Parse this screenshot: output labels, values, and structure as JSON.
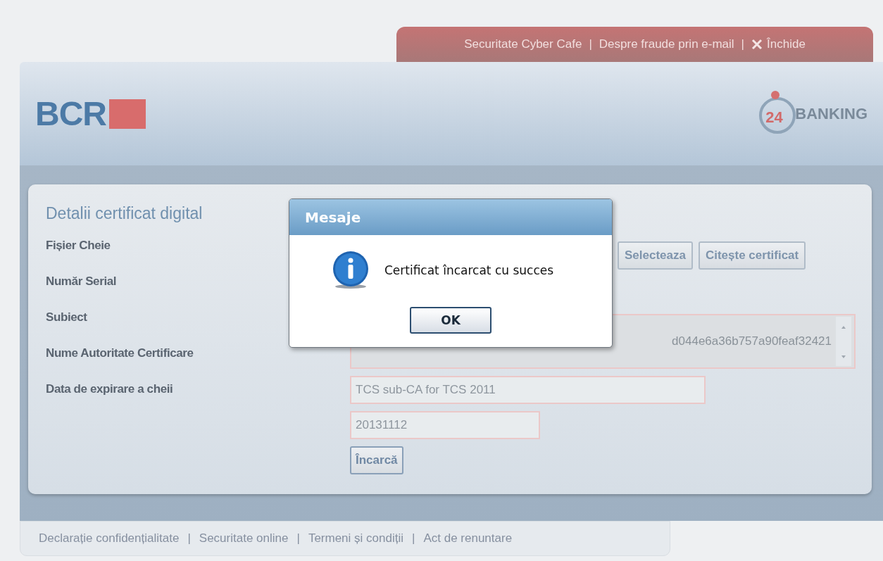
{
  "top_links": [
    {
      "label": "Securitate Cyber Cafe",
      "kind": "link"
    },
    {
      "label": "Despre fraude prin e-mail",
      "kind": "link",
      "separator": "|"
    },
    {
      "label": "Închide",
      "kind": "close",
      "separator": "|"
    }
  ],
  "header": {
    "logo": "BCR",
    "badge_number": "24",
    "badge_text": "BANKING"
  },
  "panel": {
    "title": "Detalii certificat digital",
    "labels": [
      "Fișier Cheie",
      "Număr Serial",
      "Subiect",
      "Nume Autoritate Certificare",
      "Data de expirare a cheii"
    ],
    "file_buttons": [
      "Selecteaza",
      "Citește certificat"
    ],
    "subject_value": "d044e6a36b757a90feaf32421",
    "authority_value": "TCS sub-CA for TCS 2011",
    "expiry_value": "20131112",
    "submit": "Încarcă"
  },
  "dialog": {
    "title": "Mesaje",
    "message": "Certificat încarcat cu succes",
    "button": "OK"
  },
  "footer_links": [
    {
      "label": "Declarație confidențialitate"
    },
    {
      "label": "Securitate online",
      "separator": "|"
    },
    {
      "label": "Termeni și condiții",
      "separator": "|"
    },
    {
      "label": "Act de renuntare",
      "separator": "|"
    }
  ]
}
